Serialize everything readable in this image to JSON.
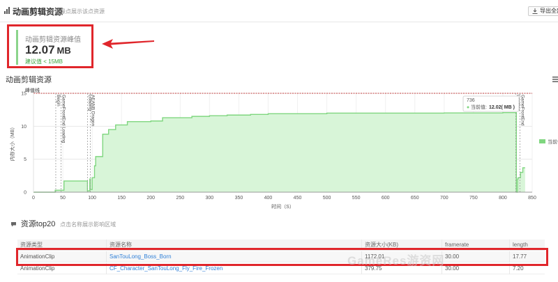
{
  "header": {
    "title": "动画剪辑资源",
    "subtitle": "点击缘点展示该点资源",
    "export_label": "导出全部数"
  },
  "peak": {
    "label": "动画剪辑资源峰值",
    "value": "12.07",
    "unit": "MB",
    "suggest": "建议值 < 15MB"
  },
  "section_title": "动画剪辑资源",
  "chart_data": {
    "type": "area",
    "xlabel": "时间（S）",
    "ylabel": "内存大小（MB）",
    "xlim": [
      0,
      850
    ],
    "ylim": [
      0,
      15
    ],
    "x_ticks": [
      "0",
      "50",
      "100",
      "150",
      "200",
      "250",
      "300",
      "350",
      "400",
      "450",
      "500",
      "550",
      "600",
      "650",
      "700",
      "750",
      "800",
      "850"
    ],
    "y_ticks": [
      "0",
      "5",
      "10",
      "15"
    ],
    "threshold": {
      "value": 15,
      "label": "峰值线"
    },
    "legend": [
      "当前值"
    ],
    "series": [
      {
        "name": "当前值",
        "x": [
          0,
          35,
          37,
          42,
          48,
          52,
          60,
          75,
          90,
          92,
          93,
          96,
          97,
          100,
          104,
          106,
          110,
          118,
          128,
          130,
          140,
          155,
          160,
          200,
          220,
          250,
          270,
          300,
          330,
          370,
          400,
          450,
          500,
          550,
          600,
          650,
          700,
          760,
          800,
          822,
          823,
          825,
          826,
          830,
          834,
          838
        ],
        "values": [
          0,
          0,
          0.3,
          0.3,
          0.3,
          1.7,
          1.7,
          1.7,
          1.7,
          0.2,
          0.2,
          2.0,
          0.4,
          2.2,
          4.0,
          5.4,
          5.4,
          8.8,
          9.5,
          9.5,
          10.2,
          10.2,
          10.7,
          10.8,
          11.3,
          11.3,
          11.5,
          11.6,
          11.7,
          11.8,
          11.9,
          11.9,
          12.0,
          12.0,
          12.0,
          12.0,
          12.02,
          12.02,
          12.07,
          12.07,
          0,
          2.0,
          2.2,
          3.0,
          3.7,
          3.7
        ]
      }
    ],
    "markers": [
      {
        "x": 38,
        "label": "Begin"
      },
      {
        "x": 47,
        "label": "GameFrontEnd Loading"
      },
      {
        "x": 92,
        "label": "Loading"
      },
      {
        "x": 97,
        "label": "AEANB Dragon"
      },
      {
        "x": 822,
        "label": "Loading"
      },
      {
        "x": 829,
        "label": "GameFrontEnd"
      }
    ],
    "tooltip": {
      "x_label": "736",
      "series_label": "当前值",
      "value": "12.02( MB )"
    }
  },
  "top20": {
    "title": "资源top20",
    "hint": "点击名称展示影响区域"
  },
  "table": {
    "headers": [
      "资源类型",
      "资源名称",
      "资源大小(KB)",
      "framerate",
      "length"
    ],
    "rows": [
      [
        "AnimationClip",
        "SanTouLong_Boss_Born",
        "1172.01",
        "30.00",
        "17.77"
      ],
      [
        "AnimationClip",
        "CF_Character_SanTouLong_Fly_Fire_Frozen",
        "379.75",
        "30.00",
        "7.20"
      ]
    ]
  },
  "watermark": "GameRes游资网",
  "colors": {
    "accent_red": "#e0262b",
    "series_fill": "#d8f5d8",
    "series_line": "#7fd67f",
    "link": "#2f7fd7"
  }
}
